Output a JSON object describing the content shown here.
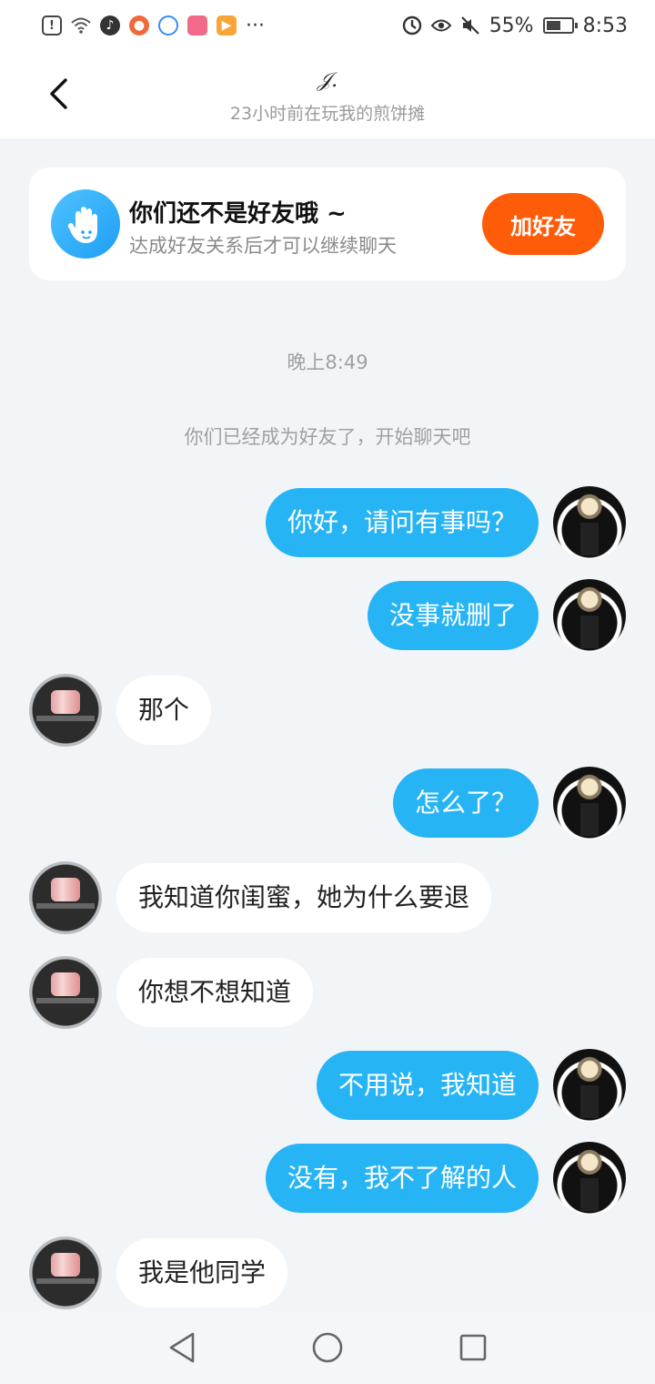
{
  "status_bar": {
    "battery_percent": "55%",
    "time": "8:53",
    "more_label": "···"
  },
  "header": {
    "title": "𝒥.",
    "subtitle": "23小时前在玩我的煎饼摊"
  },
  "friend_banner": {
    "title": "你们还不是好友哦 ~",
    "subtitle": "达成好友关系后才可以继续聊天",
    "button_label": "加好友"
  },
  "chat": {
    "time_label": "晚上8:49",
    "system_message": "你们已经成为好友了，开始聊天吧",
    "messages": [
      {
        "from": "me",
        "text": "你好，请问有事吗？"
      },
      {
        "from": "me",
        "text": "没事就删了"
      },
      {
        "from": "other",
        "text": "那个"
      },
      {
        "from": "me",
        "text": "怎么了？"
      },
      {
        "from": "other",
        "text": "我知道你闺蜜，她为什么要退"
      },
      {
        "from": "other",
        "text": "你想不想知道"
      },
      {
        "from": "me",
        "text": "不用说，我知道"
      },
      {
        "from": "me",
        "text": "没有，我不了解的人"
      },
      {
        "from": "other",
        "text": "我是他同学"
      }
    ]
  },
  "colors": {
    "accent_button": "#ff5c0a",
    "outgoing_bubble": "#27b4f5",
    "background": "#f2f5f8"
  }
}
